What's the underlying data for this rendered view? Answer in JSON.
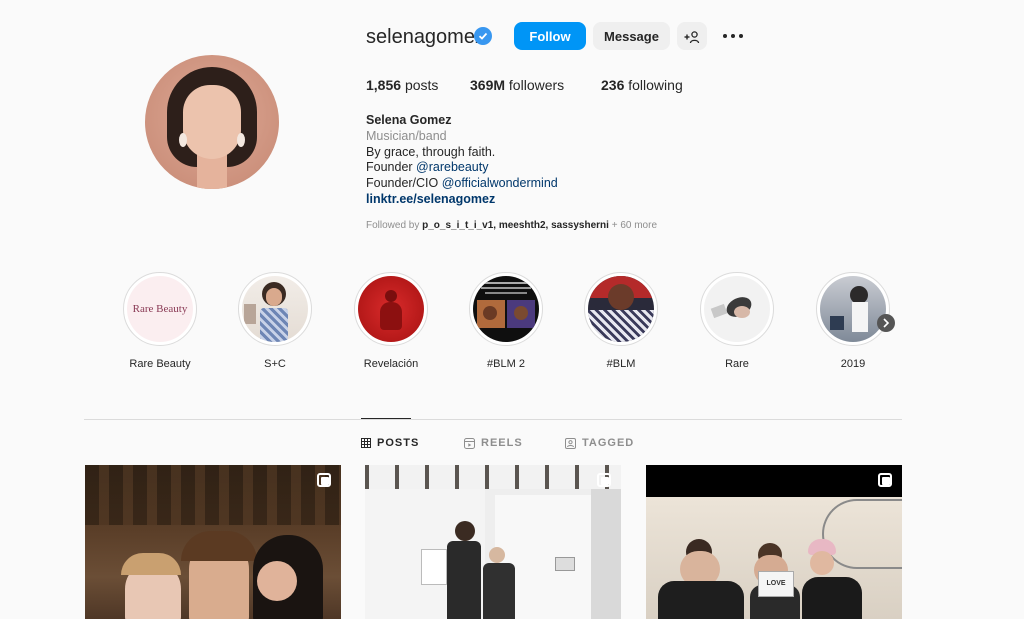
{
  "profile": {
    "username": "selenagomez",
    "follow_label": "Follow",
    "message_label": "Message",
    "add_user_label": "+",
    "stats": {
      "posts_count": "1,856",
      "posts_label": "posts",
      "followers_count": "369M",
      "followers_label": "followers",
      "following_count": "236",
      "following_label": "following"
    },
    "bio": {
      "name": "Selena Gomez",
      "category": "Musician/band",
      "line1": "By grace, through faith.",
      "founder1_prefix": "Founder ",
      "founder1_handle": "@rarebeauty",
      "founder2_prefix": "Founder/CIO ",
      "founder2_handle": "@officialwondermind",
      "link": "linktr.ee/selenagomez"
    },
    "followed_by": {
      "prefix": "Followed by ",
      "users": "p_o_s_i_t_i_v1, meeshth2, sassysherni",
      "suffix": " + 60 more"
    }
  },
  "highlights": [
    {
      "label": "Rare Beauty",
      "inner_text": "Rare Beauty"
    },
    {
      "label": "S+C"
    },
    {
      "label": "Revelación"
    },
    {
      "label": "#BLM 2"
    },
    {
      "label": "#BLM"
    },
    {
      "label": "Rare"
    },
    {
      "label": "2019"
    }
  ],
  "tabs": {
    "posts": "POSTS",
    "reels": "REELS",
    "tagged": "TAGGED"
  },
  "colors": {
    "accent": "#0095f6",
    "verified": "#3897f0",
    "link": "#00376b",
    "muted": "#8e8e8e",
    "text": "#262626",
    "background": "#fafafa"
  },
  "post_3_caption": "LOVE"
}
